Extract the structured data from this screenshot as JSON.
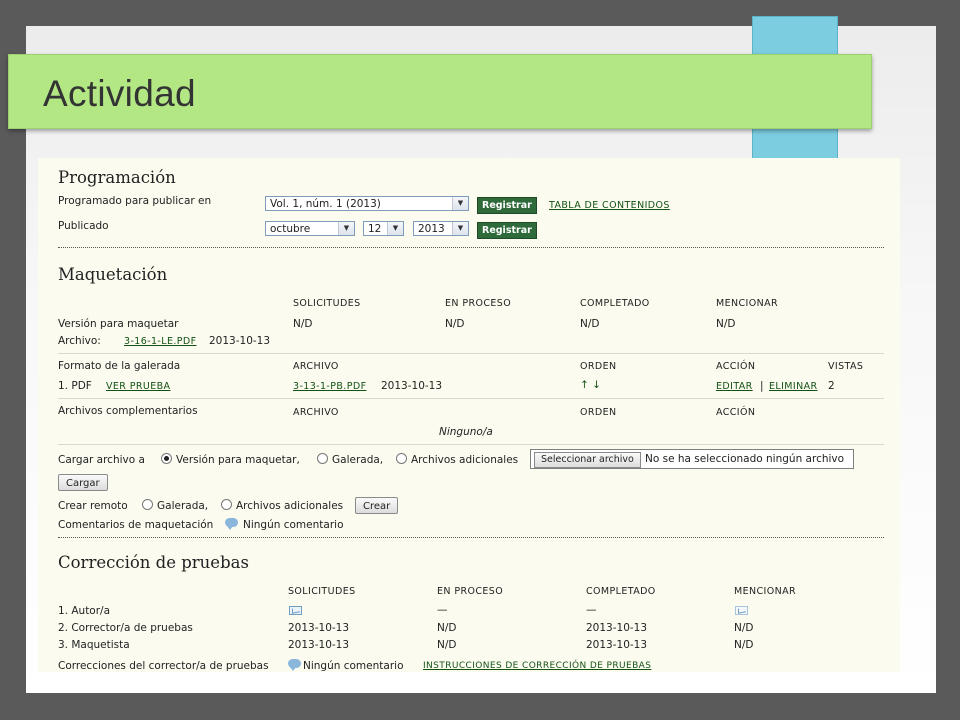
{
  "slide": {
    "title": "Actividad"
  },
  "programacion": {
    "heading": "Programación",
    "programado_label": "Programado para publicar en",
    "issue_value": "Vol. 1, núm. 1 (2013)",
    "registrar_label": "Registrar",
    "toc_link": "TABLA DE CONTENIDOS",
    "publicado_label": "Publicado",
    "month_value": "octubre",
    "day_value": "12",
    "year_value": "2013"
  },
  "maquetacion": {
    "heading": "Maquetación",
    "headers": [
      "SOLICITUDES",
      "EN PROCESO",
      "COMPLETADO",
      "MENCIONAR"
    ],
    "version_label": "Versión para maquetar",
    "version_values": [
      "N/D",
      "N/D",
      "N/D",
      "N/D"
    ],
    "archivo_label": "Archivo:",
    "archivo_link": "3-16-1-LE.PDF",
    "archivo_date": "2013-10-13",
    "galerada_label": "Formato de la galerada",
    "galerada_headers": [
      "ARCHIVO",
      "ORDEN",
      "ACCIÓN",
      "VISTAS"
    ],
    "galerada_row": {
      "name": "1. PDF",
      "view_link": "VER PRUEBA",
      "file_link": "3-13-1-PB.PDF",
      "date": "2013-10-13",
      "order": "↑ ↓",
      "edit_link": "EDITAR",
      "separator": "|",
      "delete_link": "ELIMINAR",
      "views": "2"
    },
    "complementarios_label": "Archivos complementarios",
    "complementarios_headers": [
      "ARCHIVO",
      "ORDEN",
      "ACCIÓN"
    ],
    "ninguno": "Ninguno/a",
    "cargar_label": "Cargar archivo a",
    "radio_version": "Versión para maquetar,",
    "radio_galerada": "Galerada,",
    "radio_adicionales": "Archivos adicionales",
    "file_button": "Seleccionar archivo",
    "file_status": "No se ha seleccionado ningún archivo",
    "cargar_button": "Cargar",
    "remoto_label": "Crear remoto",
    "remoto_galerada": "Galerada,",
    "remoto_adicionales": "Archivos adicionales",
    "crear_button": "Crear",
    "comentarios_label": "Comentarios de maquetación",
    "comentarios_value": "Ningún comentario"
  },
  "correccion": {
    "heading": "Corrección de pruebas",
    "headers": [
      "SOLICITUDES",
      "EN PROCESO",
      "COMPLETADO",
      "MENCIONAR"
    ],
    "rows": [
      {
        "label": "1.  Autor/a",
        "solicitudes": "",
        "proceso": "—",
        "completado": "—",
        "mencionar": ""
      },
      {
        "label": "2.  Corrector/a de pruebas",
        "solicitudes": "2013-10-13",
        "proceso": "N/D",
        "completado": "2013-10-13",
        "mencionar": "N/D"
      },
      {
        "label": "3.  Maquetista",
        "solicitudes": "2013-10-13",
        "proceso": "N/D",
        "completado": "2013-10-13",
        "mencionar": "N/D"
      }
    ],
    "correcciones_label": "Correcciones del corrector/a de pruebas",
    "correcciones_value": "Ningún comentario",
    "instrucciones_link": "INSTRUCCIONES DE CORRECCIÓN DE PRUEBAS"
  },
  "icons": {
    "select_arrow": "chevron-down-icon",
    "comment": "comment-bubble-icon",
    "email": "envelope-icon"
  }
}
